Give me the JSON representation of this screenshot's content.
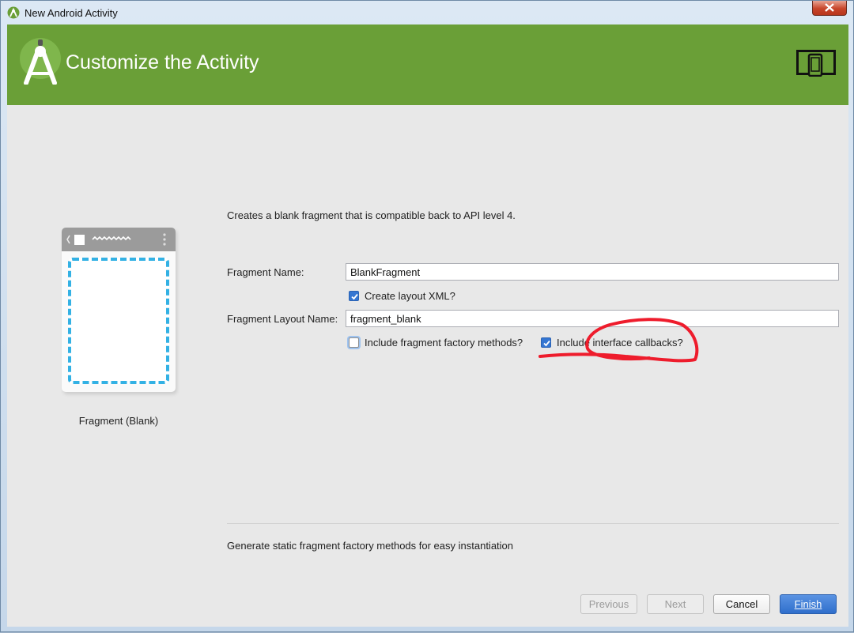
{
  "window": {
    "title": "New Android Activity"
  },
  "header": {
    "heading": "Customize the Activity"
  },
  "template": {
    "label": "Fragment (Blank)"
  },
  "form": {
    "description": "Creates a blank fragment that is compatible back to API level 4.",
    "fragment_name": {
      "label": "Fragment Name:",
      "value": "BlankFragment"
    },
    "create_layout_xml": {
      "label": "Create layout XML?",
      "checked": true
    },
    "fragment_layout_name": {
      "label": "Fragment Layout Name:",
      "value": "fragment_blank"
    },
    "include_factory_methods": {
      "label": "Include fragment factory methods?",
      "checked": false
    },
    "include_interface_callbacks": {
      "label": "Include interface callbacks?",
      "checked": true
    }
  },
  "help_text": "Generate static fragment factory methods for easy instantiation",
  "buttons": {
    "previous": "Previous",
    "next": "Next",
    "cancel": "Cancel",
    "finish": "Finish"
  },
  "colors": {
    "header_green": "#6a9f37",
    "accent_blue": "#33b1e4",
    "annotation_red": "#ee1c2c"
  }
}
